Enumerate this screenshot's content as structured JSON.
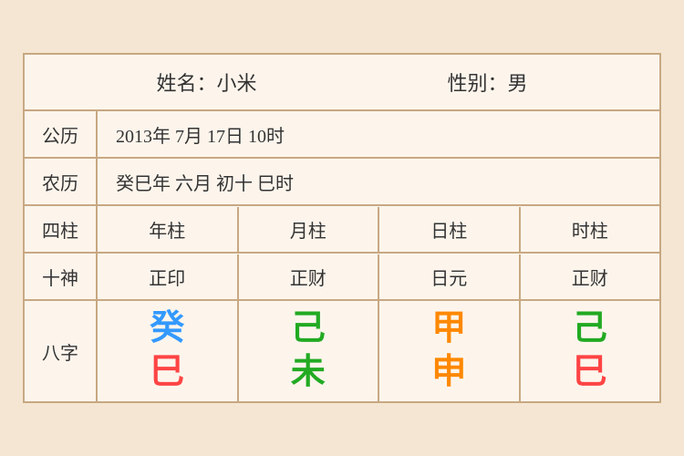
{
  "header": {
    "name_label": "姓名：小米",
    "gender_label": "性别：男"
  },
  "gongli": {
    "label": "公历",
    "value": "2013年 7月 17日 10时"
  },
  "nongli": {
    "label": "农历",
    "value": "癸巳年 六月 初十 巳时"
  },
  "sizhu": {
    "label": "四柱",
    "columns": [
      "年柱",
      "月柱",
      "日柱",
      "时柱"
    ]
  },
  "shishen": {
    "label": "十神",
    "columns": [
      "正印",
      "正财",
      "日元",
      "正财"
    ]
  },
  "bazhi": {
    "label": "八字",
    "columns": [
      {
        "top": "癸",
        "top_color": "color-blue",
        "bottom": "巳",
        "bottom_color": "color-red"
      },
      {
        "top": "己",
        "top_color": "color-green",
        "bottom": "未",
        "bottom_color": "color-green"
      },
      {
        "top": "甲",
        "top_color": "color-orange",
        "bottom": "申",
        "bottom_color": "color-orange"
      },
      {
        "top": "己",
        "top_color": "color-green",
        "bottom": "巳",
        "bottom_color": "color-red"
      }
    ]
  }
}
